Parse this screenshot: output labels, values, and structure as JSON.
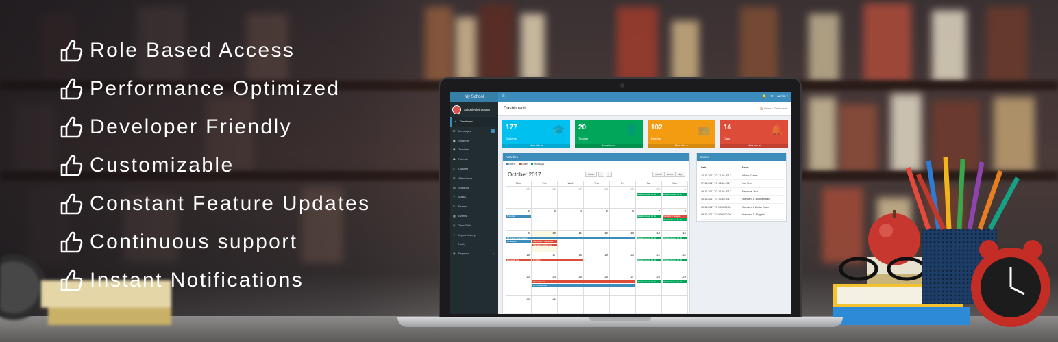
{
  "features": [
    {
      "label": "Role Based Access",
      "icon": "thumbs-up-icon"
    },
    {
      "label": "Performance Optimized",
      "icon": "thumbs-up-icon"
    },
    {
      "label": "Developer Friendly",
      "icon": "thumbs-up-icon"
    },
    {
      "label": "Customizable",
      "icon": "thumbs-up-icon"
    },
    {
      "label": "Constant Feature Updates",
      "icon": "thumbs-up-icon"
    },
    {
      "label": "Continuous support",
      "icon": "thumbs-up-icon"
    },
    {
      "label": "Instant Notifications",
      "icon": "thumbs-up-icon"
    }
  ],
  "app": {
    "brand": "My School",
    "menu_icon": "hamburger-icon",
    "user_menu": "admin ▾",
    "user_panel": "School Administrator"
  },
  "sidebar": {
    "items": [
      {
        "label": "Dashboard",
        "icon": "dashboard-icon",
        "active": true
      },
      {
        "label": "Messages",
        "icon": "envelope-icon"
      },
      {
        "label": "Students",
        "icon": "users-icon"
      },
      {
        "label": "Teachers",
        "icon": "users-icon"
      },
      {
        "label": "Parents",
        "icon": "users-icon"
      },
      {
        "label": "Classes",
        "icon": "bank-icon"
      },
      {
        "label": "Attendance",
        "icon": "list-icon"
      },
      {
        "label": "Subjects",
        "icon": "book-icon"
      },
      {
        "label": "Marks",
        "icon": "marks-icon"
      },
      {
        "label": "Exams",
        "icon": "pencil-icon"
      },
      {
        "label": "Events",
        "icon": "calendar-icon"
      },
      {
        "label": "Time Table",
        "icon": "clock-icon"
      },
      {
        "label": "Import History",
        "icon": "upload-icon"
      },
      {
        "label": "Notify",
        "icon": "bell-icon"
      },
      {
        "label": "Payment",
        "icon": "cart-icon"
      }
    ]
  },
  "header": {
    "title": "Dashboard",
    "breadcrumb": "🏠 Home > Dashboard"
  },
  "stats": [
    {
      "value": "177",
      "label": "Students",
      "more": "More info ➜",
      "color": "#00c0ef",
      "icon": "graduation-cap-icon"
    },
    {
      "value": "20",
      "label": "Teacher",
      "more": "More info ➜",
      "color": "#00a65a",
      "icon": "add-user-icon"
    },
    {
      "value": "102",
      "label": "Parents",
      "more": "More info ➜",
      "color": "#f39c12",
      "icon": "group-icon"
    },
    {
      "value": "14",
      "label": "Class",
      "more": "More info ➜",
      "color": "#dd4b39",
      "icon": "bell-icon"
    }
  ],
  "activities": {
    "title": "Activities",
    "legend": [
      {
        "label": "Event",
        "color": "#3c8dbc"
      },
      {
        "label": "Exam",
        "color": "#dd4b39"
      },
      {
        "label": "Holidays",
        "color": "#00a65a"
      }
    ],
    "month": "October 2017",
    "today_btn": "today",
    "prev_btn": "‹",
    "next_btn": "›",
    "views": [
      "month",
      "week",
      "day"
    ],
    "weekdays": [
      "Mon",
      "Tue",
      "Wed",
      "Thu",
      "Fri",
      "Sat",
      "Sun"
    ],
    "weeks": [
      [
        "25",
        "26",
        "27",
        "28",
        "29",
        "30",
        "1"
      ],
      [
        "2",
        "3",
        "4",
        "5",
        "6",
        "7",
        "8"
      ],
      [
        "9",
        "10",
        "11",
        "12",
        "13",
        "14",
        "15"
      ],
      [
        "16",
        "17",
        "18",
        "19",
        "20",
        "21",
        "22"
      ],
      [
        "23",
        "24",
        "25",
        "26",
        "27",
        "28",
        "29"
      ],
      [
        "30",
        "31",
        "",
        "",
        "",
        "",
        ""
      ]
    ],
    "events": [
      {
        "week": 0,
        "start": 5,
        "span": 1,
        "row": 0,
        "label": "Weekend leave for cla",
        "color": "#00a65a"
      },
      {
        "week": 0,
        "start": 6,
        "span": 1,
        "row": 0,
        "label": "Weekend leave for cla",
        "color": "#00a65a"
      },
      {
        "week": 1,
        "start": 0,
        "span": 1,
        "row": 0,
        "label": "8 seminar",
        "color": "#3c8dbc"
      },
      {
        "week": 1,
        "start": 5,
        "span": 1,
        "row": 0,
        "label": "Weekend leave for cla",
        "color": "#00a65a"
      },
      {
        "week": 1,
        "start": 6,
        "span": 1,
        "row": 0,
        "label": "Standard 3 - English",
        "color": "#dd4b39"
      },
      {
        "week": 1,
        "start": 6,
        "span": 1,
        "row": 1,
        "label": "Weekend leave for cla",
        "color": "#00a65a"
      },
      {
        "week": 2,
        "start": 0,
        "span": 5,
        "row": 0,
        "label": "8B Annual Sports Event",
        "color": "#3c8dbc"
      },
      {
        "week": 2,
        "start": 0,
        "span": 1,
        "row": 1,
        "label": "8A website",
        "color": "#3c8dbc"
      },
      {
        "week": 2,
        "start": 1,
        "span": 1,
        "row": 1,
        "label": "Standard 1 - Mathemat",
        "color": "#dd4b39"
      },
      {
        "week": 2,
        "start": 1,
        "span": 1,
        "row": 2,
        "label": "Standard 4 Winter Exa",
        "color": "#dd4b39"
      },
      {
        "week": 2,
        "start": 5,
        "span": 1,
        "row": 0,
        "label": "Weekend leave for cla",
        "color": "#00a65a"
      },
      {
        "week": 2,
        "start": 6,
        "span": 1,
        "row": 0,
        "label": "Weekend leave for cla",
        "color": "#00a65a"
      },
      {
        "week": 3,
        "start": 0,
        "span": 1,
        "row": 0,
        "label": "Remedial Test",
        "color": "#dd4b39"
      },
      {
        "week": 3,
        "start": 1,
        "span": 2,
        "row": 0,
        "label": "1nd Term",
        "color": "#dd4b39"
      },
      {
        "week": 3,
        "start": 5,
        "span": 1,
        "row": 0,
        "label": "Weekend leave for cla",
        "color": "#00a65a"
      },
      {
        "week": 3,
        "start": 6,
        "span": 1,
        "row": 0,
        "label": "Weekend leave for cla",
        "color": "#00a65a"
      },
      {
        "week": 4,
        "start": 1,
        "span": 4,
        "row": 0,
        "label": "Winter Exams",
        "color": "#dd4b39"
      },
      {
        "week": 4,
        "start": 1,
        "span": 4,
        "row": 1,
        "label": "8B Cultural Fest",
        "color": "#3c8dbc"
      },
      {
        "week": 4,
        "start": 5,
        "span": 1,
        "row": 0,
        "label": "Weekend leave for cla",
        "color": "#00a65a"
      },
      {
        "week": 4,
        "start": 6,
        "span": 1,
        "row": 0,
        "label": "Weekend leave for cla",
        "color": "#00a65a"
      }
    ]
  },
  "exams": {
    "title": "Exams",
    "columns": [
      "Date",
      "Exam"
    ],
    "rows": [
      [
        "24-10-2017 TO 31-10-2017",
        "Winter Exams"
      ],
      [
        "17-10-2017 TO 18-10-2017",
        "1nd Term"
      ],
      [
        "16-10-2017 TO 16-10-2017",
        "Remedial Test"
      ],
      [
        "10-10-2017 TO 10-10-2017",
        "Standard 1 - Mathematics"
      ],
      [
        "10-10-2017 TO 0000-00-00",
        "Standard 4 Winter Exam"
      ],
      [
        "08-10-2017 TO 0000-00-00",
        "Standard 3 - English"
      ]
    ]
  }
}
